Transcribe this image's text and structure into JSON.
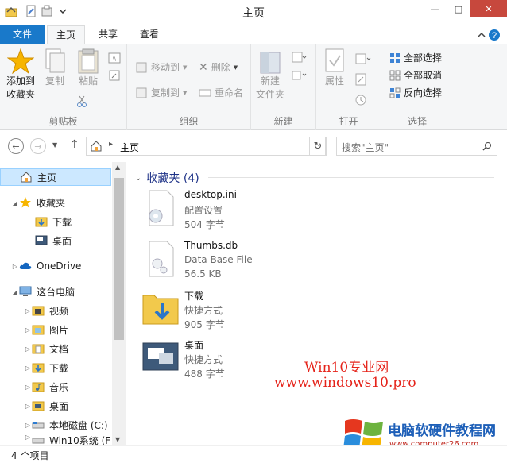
{
  "window": {
    "title": "主页"
  },
  "tabs": {
    "file": "文件",
    "home": "主页",
    "share": "共享",
    "view": "查看"
  },
  "ribbon": {
    "clipboard": {
      "label": "剪贴板",
      "pin": "添加到\n收藏夹",
      "copy": "复制",
      "paste": "粘贴"
    },
    "organize": {
      "label": "组织",
      "move_to": "移动到",
      "copy_to": "复制到",
      "delete": "删除",
      "rename": "重命名"
    },
    "new": {
      "label": "新建",
      "new_folder": "新建\n文件夹"
    },
    "open": {
      "label": "打开",
      "properties": "属性"
    },
    "select": {
      "label": "选择",
      "select_all": "全部选择",
      "select_none": "全部取消",
      "invert": "反向选择"
    }
  },
  "address": {
    "crumb": "主页",
    "search_placeholder": "搜索\"主页\""
  },
  "nav": {
    "items": [
      {
        "label": "主页",
        "level": 0,
        "selected": true,
        "icon": "home-icon"
      },
      {
        "label": "收藏夹",
        "level": 0,
        "expanded": true,
        "icon": "star-icon"
      },
      {
        "label": "下载",
        "level": 1,
        "icon": "download-folder-icon"
      },
      {
        "label": "桌面",
        "level": 1,
        "icon": "desktop-icon"
      },
      {
        "label": "OneDrive",
        "level": 0,
        "icon": "cloud-icon"
      },
      {
        "label": "这台电脑",
        "level": 0,
        "expanded": true,
        "icon": "computer-icon"
      },
      {
        "label": "视频",
        "level": 1,
        "icon": "video-folder-icon"
      },
      {
        "label": "图片",
        "level": 1,
        "icon": "pictures-folder-icon"
      },
      {
        "label": "文档",
        "level": 1,
        "icon": "documents-folder-icon"
      },
      {
        "label": "下载",
        "level": 1,
        "icon": "download-folder-icon"
      },
      {
        "label": "音乐",
        "level": 1,
        "icon": "music-folder-icon"
      },
      {
        "label": "桌面",
        "level": 1,
        "icon": "desktop-icon"
      },
      {
        "label": "本地磁盘 (C:)",
        "level": 1,
        "icon": "drive-icon"
      },
      {
        "label": "Win10系统 (F",
        "level": 1,
        "icon": "drive-icon"
      }
    ]
  },
  "content": {
    "section_title": "收藏夹 (4)",
    "files": [
      {
        "name": "desktop.ini",
        "type": "配置设置",
        "size": "504 字节",
        "icon": "settings-file-icon"
      },
      {
        "name": "Thumbs.db",
        "type": "Data Base File",
        "size": "56.5 KB",
        "icon": "database-file-icon"
      },
      {
        "name": "下载",
        "type": "快捷方式",
        "size": "905 字节",
        "icon": "download-folder-icon"
      },
      {
        "name": "桌面",
        "type": "快捷方式",
        "size": "488 字节",
        "icon": "desktop-icon"
      }
    ]
  },
  "watermark": {
    "line1": "Win10专业网",
    "line2": "www.windows10.pro"
  },
  "logo": {
    "title": "电脑软硬件教程网",
    "url": "www.computer26.com"
  },
  "status": {
    "count": "4 个项目"
  },
  "colors": {
    "accent": "#1979ca",
    "close": "#c7483d",
    "selection": "#cce8ff"
  }
}
